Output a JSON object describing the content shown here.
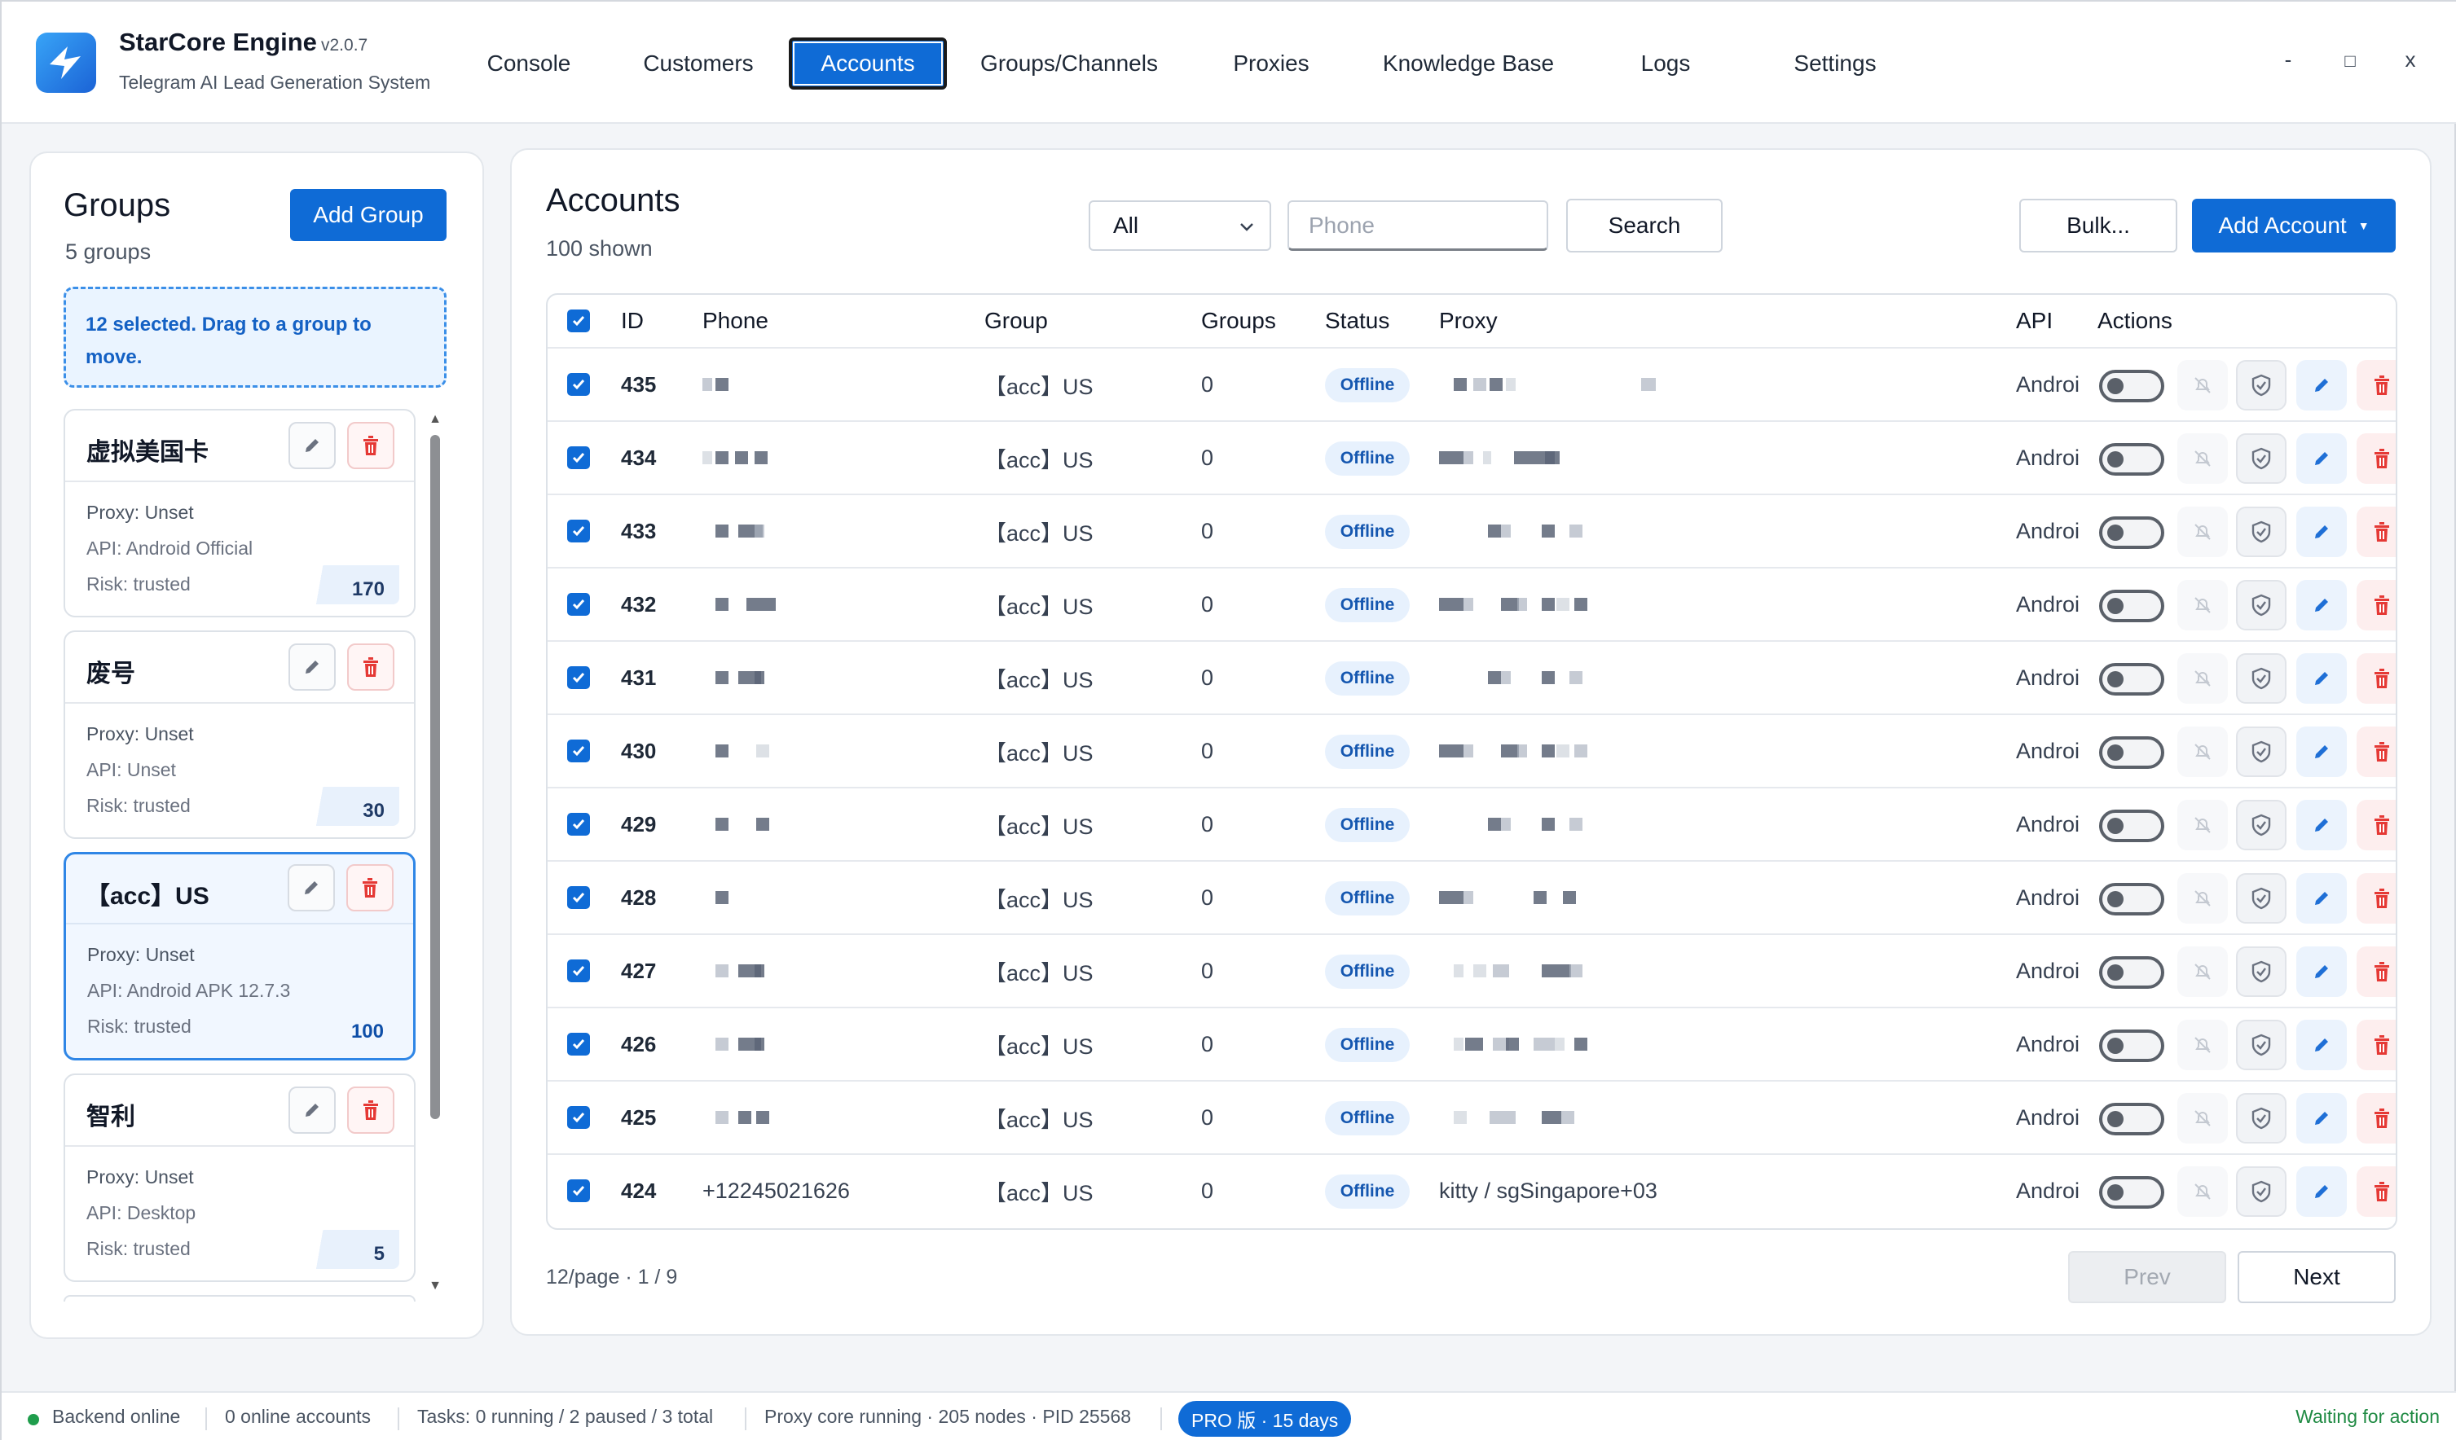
{
  "app": {
    "name": "StarCore Engine",
    "version": "v2.0.7",
    "subtitle": "Telegram AI Lead Generation System"
  },
  "nav": {
    "tabs": [
      "Console",
      "Customers",
      "Accounts",
      "Groups/Channels",
      "Proxies",
      "Knowledge Base",
      "Logs",
      "Settings"
    ],
    "active": "Accounts"
  },
  "window_controls": {
    "minimize": "-",
    "maximize": "□",
    "close": "x"
  },
  "groups_panel": {
    "title": "Groups",
    "count_label": "5 groups",
    "add_button": "Add Group",
    "drag_hint": "12 selected. Drag to a group to move.",
    "groups": [
      {
        "name": "虚拟美国卡",
        "proxy": "Proxy: Unset",
        "api": "API: Android Official",
        "risk": "Risk: trusted",
        "count": "170",
        "selected": false
      },
      {
        "name": "废号",
        "proxy": "Proxy: Unset",
        "api": "API: Unset",
        "risk": "Risk: trusted",
        "count": "30",
        "selected": false
      },
      {
        "name": "【acc】US",
        "proxy": "Proxy: Unset",
        "api": "API: Android APK 12.7.3",
        "risk": "Risk: trusted",
        "count": "100",
        "selected": true
      },
      {
        "name": "智利",
        "proxy": "Proxy: Unset",
        "api": "API: Desktop",
        "risk": "Risk: trusted",
        "count": "5",
        "selected": false
      }
    ]
  },
  "accounts_panel": {
    "title": "Accounts",
    "shown_label": "100 shown",
    "filter_value": "All",
    "phone_placeholder": "Phone",
    "search_button": "Search",
    "bulk_button": "Bulk...",
    "add_button": "Add Account",
    "add_button_caret": "▼",
    "columns": [
      "ID",
      "Phone",
      "Group",
      "Groups",
      "Status",
      "Proxy",
      "API",
      "Actions"
    ],
    "rows": [
      {
        "id": "435",
        "phone": "",
        "group": "【acc】US",
        "groups": "0",
        "status": "Offline",
        "proxy": "",
        "api": "Androi"
      },
      {
        "id": "434",
        "phone": "",
        "group": "【acc】US",
        "groups": "0",
        "status": "Offline",
        "proxy": "",
        "api": "Androi"
      },
      {
        "id": "433",
        "phone": "",
        "group": "【acc】US",
        "groups": "0",
        "status": "Offline",
        "proxy": "",
        "api": "Androi"
      },
      {
        "id": "432",
        "phone": "",
        "group": "【acc】US",
        "groups": "0",
        "status": "Offline",
        "proxy": "",
        "api": "Androi"
      },
      {
        "id": "431",
        "phone": "",
        "group": "【acc】US",
        "groups": "0",
        "status": "Offline",
        "proxy": "",
        "api": "Androi"
      },
      {
        "id": "430",
        "phone": "",
        "group": "【acc】US",
        "groups": "0",
        "status": "Offline",
        "proxy": "",
        "api": "Androi"
      },
      {
        "id": "429",
        "phone": "",
        "group": "【acc】US",
        "groups": "0",
        "status": "Offline",
        "proxy": "",
        "api": "Androi"
      },
      {
        "id": "428",
        "phone": "",
        "group": "【acc】US",
        "groups": "0",
        "status": "Offline",
        "proxy": "",
        "api": "Androi"
      },
      {
        "id": "427",
        "phone": "",
        "group": "【acc】US",
        "groups": "0",
        "status": "Offline",
        "proxy": "",
        "api": "Androi"
      },
      {
        "id": "426",
        "phone": "",
        "group": "【acc】US",
        "groups": "0",
        "status": "Offline",
        "proxy": "",
        "api": "Androi"
      },
      {
        "id": "425",
        "phone": "",
        "group": "【acc】US",
        "groups": "0",
        "status": "Offline",
        "proxy": "",
        "api": "Androi"
      },
      {
        "id": "424",
        "phone": "+12245021626",
        "group": "【acc】US",
        "groups": "0",
        "status": "Offline",
        "proxy": "kitty / sgSingapore+03",
        "api": "Androi"
      }
    ],
    "pagination": {
      "info": "12/page · 1 / 9",
      "prev": "Prev",
      "next": "Next"
    }
  },
  "statusbar": {
    "backend": "Backend online",
    "online_accounts": "0 online accounts",
    "tasks": "Tasks: 0 running / 2 paused / 3 total",
    "proxy_core": "Proxy core running · 205 nodes · PID 25568",
    "license": "PRO 版 · 15 days",
    "state": "Waiting for action"
  },
  "icons": {
    "logo": "starcore-logo-icon",
    "edit": "pencil-icon",
    "delete": "trash-icon",
    "mute": "bell-off-icon",
    "shield": "shield-check-icon",
    "checkbox": "check-icon"
  },
  "colors": {
    "accent": "#0f6bd6",
    "danger": "#e53935",
    "success": "#1f9d4c",
    "badge_bg": "#e7f1fd"
  }
}
